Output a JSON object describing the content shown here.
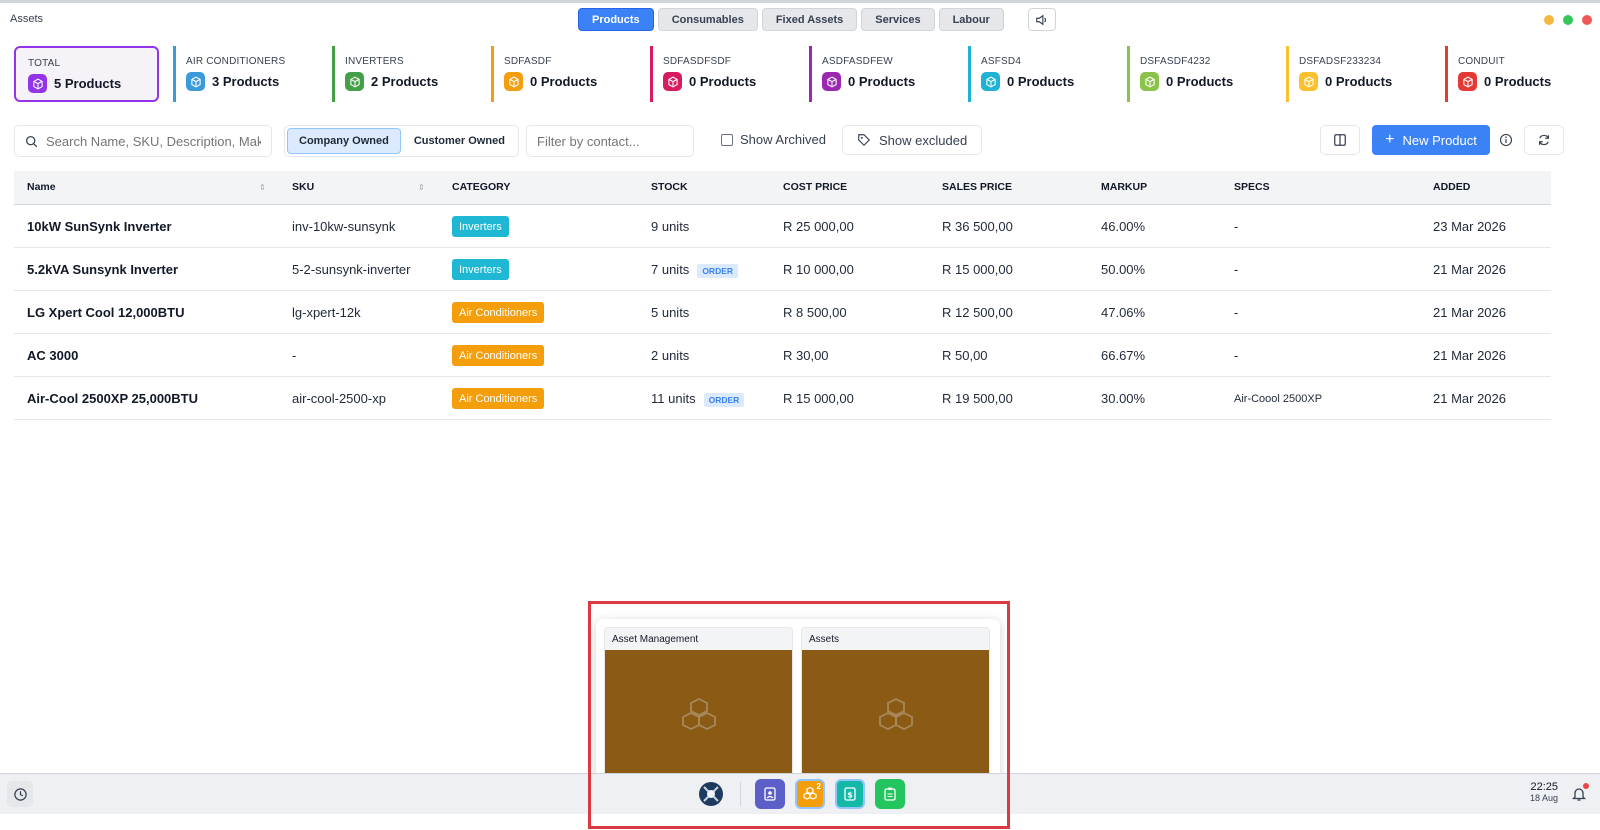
{
  "window": {
    "title": "Assets"
  },
  "tabs": [
    {
      "label": "Products",
      "active": true
    },
    {
      "label": "Consumables",
      "active": false
    },
    {
      "label": "Fixed Assets",
      "active": false
    },
    {
      "label": "Services",
      "active": false
    },
    {
      "label": "Labour",
      "active": false
    }
  ],
  "window_controls": [
    "#f5b93f",
    "#35c759",
    "#f25757"
  ],
  "summary_cards": [
    {
      "label": "TOTAL",
      "count": "5 Products",
      "color": "#9333ea"
    },
    {
      "label": "AIR CONDITIONERS",
      "count": "3 Products",
      "color": "#3b9ad9"
    },
    {
      "label": "INVERTERS",
      "count": "2 Products",
      "color": "#43a047"
    },
    {
      "label": "SDFASDF",
      "count": "0 Products",
      "color": "#f59e0b"
    },
    {
      "label": "SDFASDFSDF",
      "count": "0 Products",
      "color": "#d81b60"
    },
    {
      "label": "ASDFASDFEW",
      "count": "0 Products",
      "color": "#9c27b0"
    },
    {
      "label": "ASFSD4",
      "count": "0 Products",
      "color": "#1eb3d4"
    },
    {
      "label": "DSFASDF4232",
      "count": "0 Products",
      "color": "#8bc34a"
    },
    {
      "label": "DSFADSF233234",
      "count": "0 Products",
      "color": "#fbc02d"
    },
    {
      "label": "CONDUIT",
      "count": "0 Products",
      "color": "#e53935"
    }
  ],
  "filters": {
    "search_placeholder": "Search Name, SKU, Description, Make, Model...",
    "owner_options": [
      {
        "label": "Company Owned",
        "active": true
      },
      {
        "label": "Customer Owned",
        "active": false
      }
    ],
    "contact_placeholder": "Filter by contact...",
    "show_archived": "Show Archived",
    "show_excluded": "Show excluded",
    "new_product": "New Product"
  },
  "table": {
    "headers": [
      "Name",
      "SKU",
      "CATEGORY",
      "STOCK",
      "COST PRICE",
      "SALES PRICE",
      "MARKUP",
      "SPECS",
      "ADDED"
    ],
    "rows": [
      {
        "name": "10kW SunSynk Inverter",
        "sku": "inv-10kw-sunsynk",
        "category": "Inverters",
        "category_color": "#1eb8d4",
        "stock": "9 units",
        "order": "",
        "cost": "R 25 000,00",
        "sales": "R 36 500,00",
        "markup": "46.00%",
        "specs": "-",
        "added": "23 Mar 2026"
      },
      {
        "name": "5.2kVA Sunsynk Inverter",
        "sku": "5-2-sunsynk-inverter",
        "category": "Inverters",
        "category_color": "#1eb8d4",
        "stock": "7 units",
        "order": "ORDER",
        "cost": "R 10 000,00",
        "sales": "R 15 000,00",
        "markup": "50.00%",
        "specs": "-",
        "added": "21 Mar 2026"
      },
      {
        "name": "LG Xpert Cool 12,000BTU",
        "sku": "lg-xpert-12k",
        "category": "Air Conditioners",
        "category_color": "#f59e0b",
        "stock": "5 units",
        "order": "",
        "cost": "R 8 500,00",
        "sales": "R 12 500,00",
        "markup": "47.06%",
        "specs": "-",
        "added": "21 Mar 2026"
      },
      {
        "name": "AC 3000",
        "sku": "-",
        "category": "Air Conditioners",
        "category_color": "#f59e0b",
        "stock": "2 units",
        "order": "",
        "cost": "R 30,00",
        "sales": "R 50,00",
        "markup": "66.67%",
        "specs": "-",
        "added": "21 Mar 2026"
      },
      {
        "name": "Air-Cool 2500XP 25,000BTU",
        "sku": "air-cool-2500-xp",
        "category": "Air Conditioners",
        "category_color": "#f59e0b",
        "stock": "11 units",
        "order": "ORDER",
        "cost": "R 15 000,00",
        "sales": "R 19 500,00",
        "markup": "30.00%",
        "specs": "Air-Coool 2500XP",
        "added": "21 Mar 2026"
      }
    ]
  },
  "popup": {
    "previews": [
      {
        "title": "Asset Management"
      },
      {
        "title": "Assets"
      }
    ]
  },
  "taskbar": {
    "time": "22:25",
    "date": "18 Aug",
    "assets_badge": "2"
  }
}
